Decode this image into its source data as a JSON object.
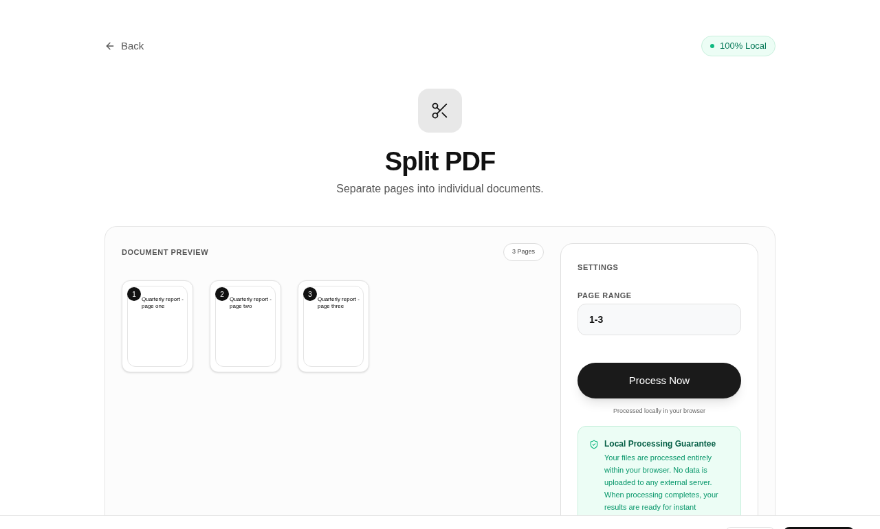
{
  "header": {
    "back": "Back",
    "badge": "100% Local"
  },
  "title": "Split PDF",
  "subtitle": "Separate pages into individual documents.",
  "preview": {
    "heading": "DOCUMENT PREVIEW",
    "count": "3 Pages",
    "pages": [
      {
        "number": "1",
        "text": "Quarterly report - page one"
      },
      {
        "number": "2",
        "text": "Quarterly report - page two"
      },
      {
        "number": "3",
        "text": "Quarterly report - page three"
      }
    ]
  },
  "settings": {
    "heading": "SETTINGS",
    "range_label": "PAGE RANGE",
    "range_value": "1-3",
    "button": "Process Now",
    "note": "Processed locally in your browser",
    "guarantee": {
      "title": "Local Processing Guarantee",
      "text": "Your files are processed entirely within your browser. No data is uploaded to any external server. When processing completes, your results are ready for instant"
    }
  }
}
